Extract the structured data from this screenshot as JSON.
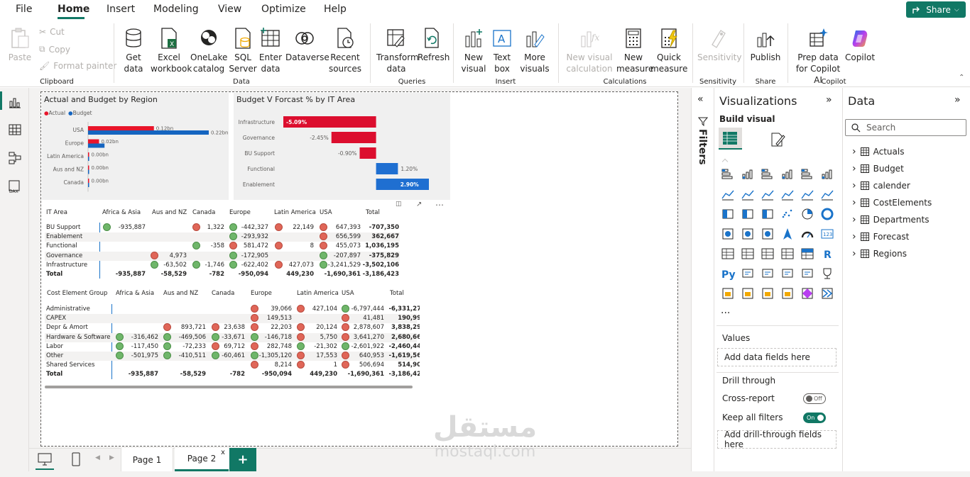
{
  "menu": {
    "items": [
      "File",
      "Home",
      "Insert",
      "Modeling",
      "View",
      "Optimize",
      "Help"
    ],
    "share_label": "Share"
  },
  "ribbon": {
    "clipboard": {
      "paste": "Paste",
      "cut": "Cut",
      "copy": "Copy",
      "format_painter": "Format painter",
      "group": "Clipboard"
    },
    "data": {
      "get_data": "Get data",
      "excel": "Excel workbook",
      "onelake": "OneLake catalog",
      "sql": "SQL Server",
      "enter": "Enter data",
      "dataverse": "Dataverse",
      "recent": "Recent sources",
      "group": "Data"
    },
    "queries": {
      "transform": "Transform data",
      "refresh": "Refresh",
      "group": "Queries"
    },
    "insert": {
      "new_visual": "New visual",
      "text_box": "Text box",
      "more_visuals": "More visuals",
      "group": "Insert"
    },
    "calculations": {
      "new_visual_calc": "New visual calculation",
      "new_measure": "New measure",
      "quick_measure": "Quick measure",
      "group": "Calculations"
    },
    "sensitivity": {
      "label": "Sensitivity",
      "group": "Sensitivity"
    },
    "share": {
      "publish": "Publish",
      "group": "Share"
    },
    "copilot": {
      "prep": "Prep data for Copilot",
      "ai": "AI",
      "copilot": "Copilot",
      "group": "Copilot"
    }
  },
  "colors": {
    "accent": "#117865",
    "actual": "#e8152b",
    "budget": "#1565c0",
    "negative": "#dc0e2e",
    "positive": "#1f6fd1"
  },
  "chart1": {
    "title": "Actual and Budget by Region",
    "legend": [
      "Actual",
      "Budget"
    ]
  },
  "chart2": {
    "title": "Budget V Forcast % by IT Area"
  },
  "chart_data": [
    {
      "type": "bar",
      "title": "Actual and Budget by Region",
      "categories": [
        "USA",
        "Europe",
        "Latin America",
        "Aus and NZ",
        "Canada"
      ],
      "series": [
        {
          "name": "Actual",
          "values": [
            0.12,
            0.02,
            0.0,
            0.0,
            0.0
          ],
          "labels": [
            "0.12bn",
            "0.02bn",
            "0.00bn",
            "0.00bn",
            "0.00bn"
          ]
        },
        {
          "name": "Budget",
          "values": [
            0.22,
            0.03,
            0.002,
            0.001,
            0.001
          ],
          "labels": [
            "0.22bn",
            "",
            "",
            "",
            ""
          ]
        }
      ],
      "orientation": "horizontal",
      "legend": "top-left",
      "xlim": [
        0,
        0.22
      ]
    },
    {
      "type": "bar",
      "title": "Budget V Forcast % by IT Area",
      "categories": [
        "Infrastructure",
        "Governance",
        "BU Support",
        "Functional",
        "Enablement"
      ],
      "values": [
        -5.09,
        -2.45,
        -0.9,
        1.2,
        2.9
      ],
      "labels": [
        "-5.09%",
        "-2.45%",
        "-0.90%",
        "1.20%",
        "2.90%"
      ],
      "orientation": "horizontal",
      "xlim": [
        -5.09,
        2.9
      ]
    }
  ],
  "matrix1": {
    "headers": [
      "IT Area",
      "Africa & Asia",
      "Aus and NZ",
      "Canada",
      "Europe",
      "Latin America",
      "USA",
      "Total"
    ],
    "rows": [
      {
        "label": "BU Support",
        "vals": [
          "-935,887",
          "",
          "1,322",
          "-442,327",
          "22,149",
          "647,393",
          "-707,350"
        ],
        "dots": [
          "g",
          "",
          "r",
          "g",
          "r",
          "r"
        ]
      },
      {
        "label": "Enablement",
        "vals": [
          "",
          "",
          "",
          "-293,932",
          "",
          "656,599",
          "362,667"
        ],
        "dots": [
          "",
          "",
          "",
          "g",
          "",
          "r"
        ]
      },
      {
        "label": "Functional",
        "vals": [
          "",
          "",
          "-358",
          "581,472",
          "8",
          "455,073",
          "1,036,195"
        ],
        "dots": [
          "",
          "",
          "g",
          "r",
          "r",
          "r"
        ]
      },
      {
        "label": "Governance",
        "vals": [
          "",
          "4,973",
          "",
          "-172,905",
          "",
          "-207,897",
          "-375,829"
        ],
        "dots": [
          "",
          "r",
          "",
          "g",
          "",
          "g"
        ]
      },
      {
        "label": "Infrastructure",
        "vals": [
          "",
          "-63,502",
          "-1,746",
          "-622,402",
          "427,073",
          "-3,241,529",
          "-3,502,106"
        ],
        "dots": [
          "",
          "g",
          "g",
          "g",
          "r",
          "g"
        ]
      },
      {
        "label": "Total",
        "vals": [
          "-935,887",
          "-58,529",
          "-782",
          "-950,094",
          "449,230",
          "-1,690,361",
          "-3,186,423"
        ],
        "dots": [
          "",
          "",
          "",
          "",
          "",
          ""
        ]
      }
    ]
  },
  "matrix2": {
    "headers": [
      "Cost Element Group",
      "Africa & Asia",
      "Aus and NZ",
      "Canada",
      "Europe",
      "Latin America",
      "USA",
      "Total"
    ],
    "rows": [
      {
        "label": "Administrative",
        "vals": [
          "",
          "",
          "",
          "39,066",
          "427,104",
          "-6,797,444",
          "-6,331,27"
        ],
        "dots": [
          "",
          "",
          "",
          "r",
          "r",
          "g"
        ]
      },
      {
        "label": "CAPEX",
        "vals": [
          "",
          "",
          "",
          "149,513",
          "",
          "41,481",
          "190,99"
        ],
        "dots": [
          "",
          "",
          "",
          "r",
          "",
          "r"
        ]
      },
      {
        "label": "Depr & Amort",
        "vals": [
          "",
          "893,721",
          "23,638",
          "22,203",
          "20,124",
          "2,878,607",
          "3,838,29"
        ],
        "dots": [
          "",
          "r",
          "r",
          "r",
          "r",
          "r"
        ]
      },
      {
        "label": "Hardware & Software",
        "vals": [
          "-316,462",
          "-469,506",
          "-33,671",
          "-146,718",
          "5,750",
          "3,641,270",
          "2,680,66"
        ],
        "dots": [
          "g",
          "g",
          "g",
          "g",
          "r",
          "r"
        ]
      },
      {
        "label": "Labor",
        "vals": [
          "-117,450",
          "-72,233",
          "69,712",
          "282,748",
          "-21,302",
          "-2,601,922",
          "-2,460,44"
        ],
        "dots": [
          "g",
          "g",
          "r",
          "r",
          "g",
          "g"
        ]
      },
      {
        "label": "Other",
        "vals": [
          "-501,975",
          "-410,511",
          "-60,461",
          "-1,305,120",
          "17,553",
          "640,953",
          "-1,619,56"
        ],
        "dots": [
          "g",
          "g",
          "g",
          "g",
          "r",
          "r"
        ]
      },
      {
        "label": "Shared Services",
        "vals": [
          "",
          "",
          "",
          "8,214",
          "1",
          "506,694",
          "514,90"
        ],
        "dots": [
          "",
          "",
          "",
          "r",
          "r",
          "r"
        ]
      },
      {
        "label": "Total",
        "vals": [
          "-935,887",
          "-58,529",
          "-782",
          "-950,094",
          "449,230",
          "-1,690,361",
          "-3,186,42"
        ],
        "dots": [
          "",
          "",
          "",
          "",
          "",
          ""
        ]
      }
    ]
  },
  "filters_label": "Filters",
  "visualizations": {
    "title": "Visualizations",
    "build_visual": "Build visual",
    "values_label": "Values",
    "values_placeholder": "Add data fields here",
    "drill_through": "Drill through",
    "cross_report": "Cross-report",
    "cross_report_state": "Off",
    "keep_filters": "Keep all filters",
    "keep_filters_state": "On",
    "drill_placeholder": "Add drill-through fields here",
    "more": "..."
  },
  "data_pane": {
    "title": "Data",
    "search_placeholder": "Search",
    "tables": [
      "Actuals",
      "Budget",
      "calender",
      "CostElements",
      "Departments",
      "Forecast",
      "Regions"
    ]
  },
  "pages": {
    "tabs": [
      "Page 1",
      "Page 2"
    ],
    "add": "+",
    "close": "x"
  },
  "watermark": {
    "arabic": "مستقل",
    "latin": "mostaql.com"
  }
}
